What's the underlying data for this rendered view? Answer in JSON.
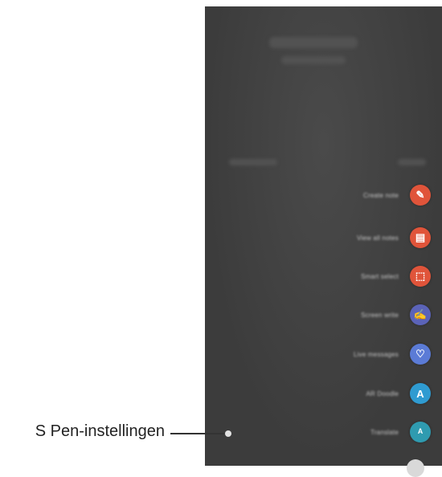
{
  "menu": {
    "items": [
      {
        "label": "Create note",
        "glyph": "✎",
        "color": "#e0543a"
      },
      {
        "label": "View all notes",
        "glyph": "▤",
        "color": "#e0543a"
      },
      {
        "label": "Smart select",
        "glyph": "⬚",
        "color": "#e0543a"
      },
      {
        "label": "Screen write",
        "glyph": "✍",
        "color": "#5b63b8"
      },
      {
        "label": "Live messages",
        "glyph": "♡",
        "color": "#5b7bd6"
      },
      {
        "label": "AR Doodle",
        "glyph": "A",
        "color": "#2f9bd1"
      },
      {
        "label": "Translate",
        "glyph": "ᴬ",
        "color": "#2f9bb0"
      }
    ]
  },
  "callout": {
    "label": "S Pen-instellingen"
  }
}
